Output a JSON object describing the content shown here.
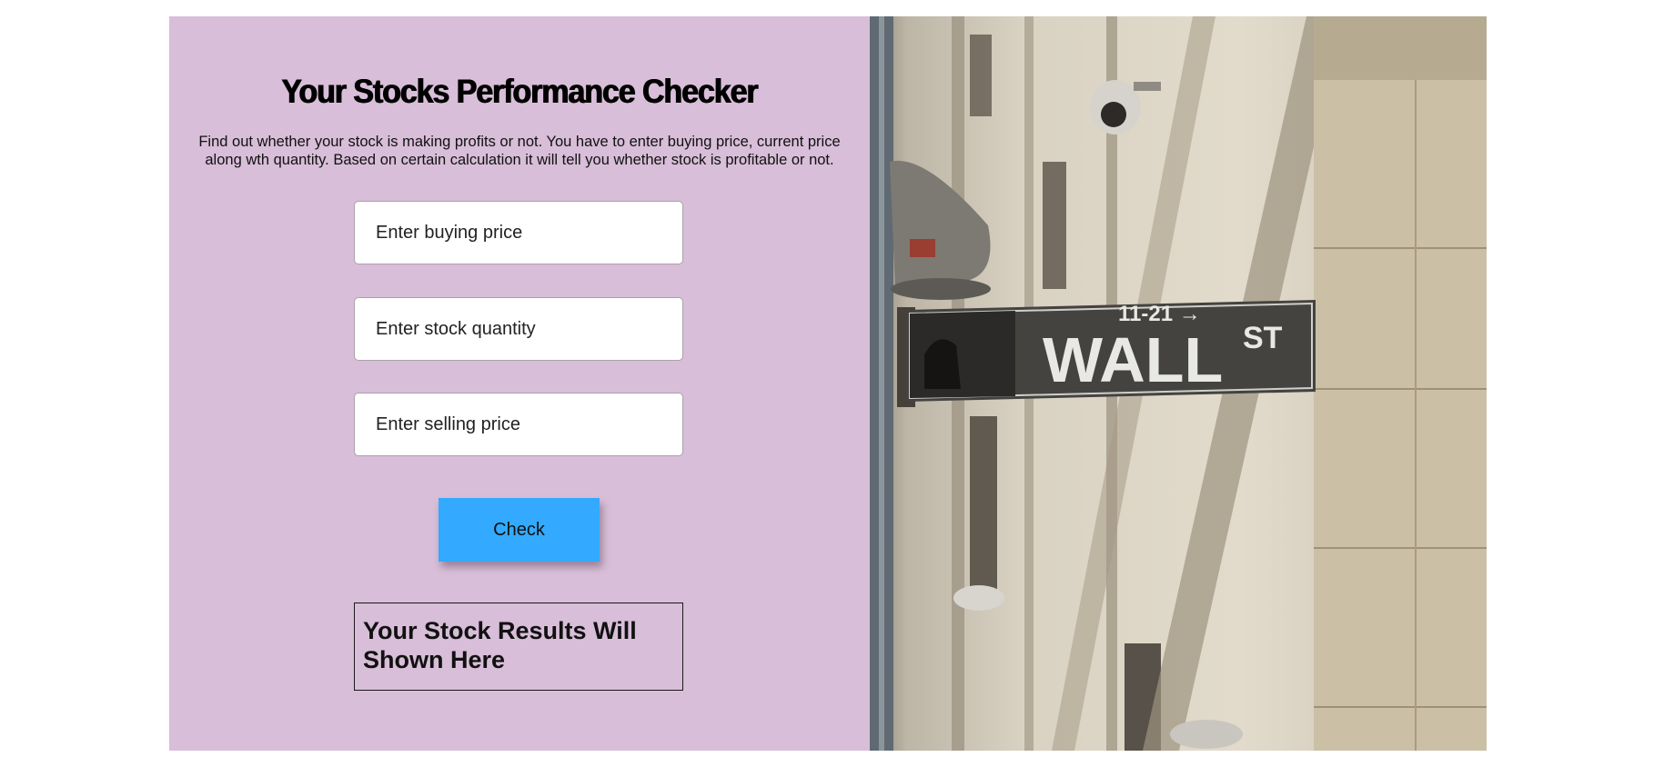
{
  "page": {
    "title": "Your Stocks Performance Checker",
    "description": "Find out whether your stock is making profits or not. You have to enter buying price, current price along wth quantity. Based on certain calculation it will tell you whether stock is profitable or not."
  },
  "form": {
    "buying_price": {
      "placeholder": "Enter buying price",
      "value": ""
    },
    "quantity": {
      "placeholder": "Enter stock quantity",
      "value": ""
    },
    "selling_price": {
      "placeholder": "Enter selling price",
      "value": ""
    },
    "check_label": "Check"
  },
  "result": {
    "text": "Your Stock Results Will Shown Here"
  },
  "photo": {
    "sign_main": "WALL",
    "sign_suffix": "ST",
    "sign_numbers": "11-21 →"
  },
  "colors": {
    "panel_background": "#d8bed8",
    "button_background": "#33aaff",
    "page_background": "#ffffff"
  },
  "icons": {
    "photo": "wall-street-sign-photo"
  }
}
